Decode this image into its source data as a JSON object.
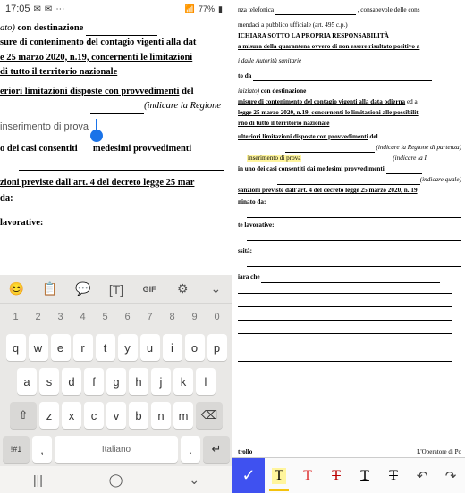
{
  "status": {
    "time": "17:05",
    "icons_left": [
      "✉",
      "✉",
      "⋯"
    ],
    "signal": "📶",
    "battery": "77%",
    "battery_icon": "▮"
  },
  "left_doc": {
    "l1a": "ato) ",
    "l1b": "con destinazione ",
    "l2": "sure di contenimento del contagio vigenti alla dat",
    "l3a": "e 25 marzo 2020, n.19, ",
    "l3b": "concernenti le limitazioni ",
    "l4": "di tutto il territorio nazionale",
    "l5a": "eriori limitazioni disposte con provvedimenti",
    "l5b": " del",
    "l6": "(indicare la Regione",
    "input": "inserimento di prova",
    "l7a": "o dei casi consentiti",
    "l7b": "medesimi provvedimenti",
    "l8": "zioni previste dall'art. 4 del decreto legge 25 mar",
    "l9": "da:",
    "l10": "lavorative:"
  },
  "keyboard": {
    "toolbar": [
      "😊",
      "📋",
      "💬",
      "[T]",
      "GIF",
      "⚙",
      "⌄"
    ],
    "row_num": [
      "1",
      "2",
      "3",
      "4",
      "5",
      "6",
      "7",
      "8",
      "9",
      "0"
    ],
    "row1": [
      "q",
      "w",
      "e",
      "r",
      "t",
      "y",
      "u",
      "i",
      "o",
      "p"
    ],
    "row2": [
      "a",
      "s",
      "d",
      "f",
      "g",
      "h",
      "j",
      "k",
      "l"
    ],
    "row3_shift": "⇧",
    "row3": [
      "z",
      "x",
      "c",
      "v",
      "b",
      "n",
      "m"
    ],
    "row3_del": "⌫",
    "row4_sym": "!#1",
    "row4_comma": ",",
    "row4_space": "Italiano",
    "row4_dot": ".",
    "row4_enter": "↵",
    "nav": [
      "|||",
      "◯",
      "⌄"
    ]
  },
  "right_doc": {
    "l1a": "nza telefonica ",
    "l1b": " , consapevole delle cons",
    "l2": "mendaci a pubblico ufficiale (art. 495 c.p.)",
    "l3": "ICHIARA SOTTO LA PROPRIA RESPONSABILITÀ",
    "l4": "a misura della quarantena ovvero di non essere risultato positivo a",
    "l5": "i dalle Autorità sanitarie",
    "l6": "to da ",
    "l7a": "iniziato) ",
    "l7b": "con destinazione ",
    "l8a": "misure di contenimento del contagio vigenti alla data odierna",
    "l8b": " ed a",
    "l9a": "legge 25 marzo 2020, n.19, ",
    "l9b": "concernenti le limitazioni alle possibilit",
    "l10": "rno di tutto il territorio nazionale",
    "l11a": "ulteriori limitazioni disposte con provvedimenti",
    "l11b": " del",
    "l12": "(indicare la Regione di partenza)",
    "l13a": "inserimento di prova",
    "l13b": "(indicare la I",
    "l14a": "in uno dei casi consentiti dai medesimi provvedimenti",
    "l14b": "(indicare quale)",
    "l15": "sanzioni previste dall'art. 4 del decreto legge 25 marzo 2020, n. 19",
    "l16": "ninato da:",
    "l17": "te lavorative:",
    "l18": "ssità:",
    "l19": "iara che ",
    "foot_left": "trollo",
    "foot_right": "L'Operatore di Po"
  },
  "right_toolbar": {
    "check": "✓",
    "t_hl": "T",
    "t_plain": "T",
    "t_strike": "T",
    "t_under": "T",
    "t_dstrike": "T",
    "undo": "↶",
    "redo": "↷"
  }
}
